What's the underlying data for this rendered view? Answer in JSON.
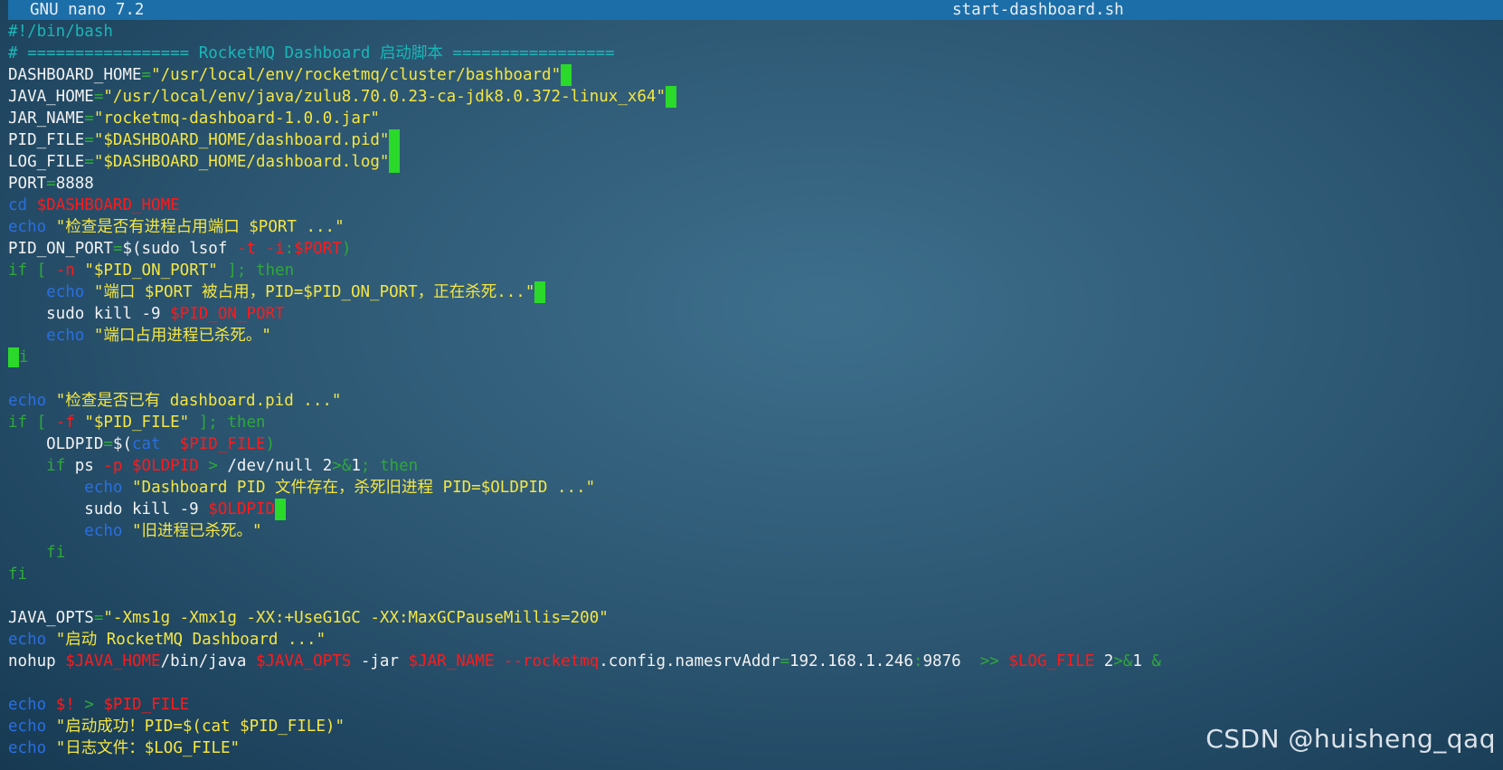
{
  "titlebar": {
    "version": "GNU nano 7.2",
    "filename": "start-dashboard.sh"
  },
  "lines": [
    [
      {
        "c": "cm",
        "t": "#!/bin/bash"
      }
    ],
    [
      {
        "c": "cm",
        "t": "# ================= RocketMQ Dashboard 启动脚本 ================="
      }
    ],
    [
      {
        "c": "pl",
        "t": "DASHBOARD_HOME"
      },
      {
        "c": "op",
        "t": "="
      },
      {
        "c": "str",
        "t": "\"/usr/local/env/rocketmq/cluster/bashboard\""
      },
      {
        "c": "tr",
        "t": ""
      }
    ],
    [
      {
        "c": "pl",
        "t": "JAVA_HOME"
      },
      {
        "c": "op",
        "t": "="
      },
      {
        "c": "str",
        "t": "\"/usr/local/env/java/zulu8.70.0.23-ca-jdk8.0.372-linux_x64\""
      },
      {
        "c": "tr",
        "t": ""
      }
    ],
    [
      {
        "c": "pl",
        "t": "JAR_NAME"
      },
      {
        "c": "op",
        "t": "="
      },
      {
        "c": "str",
        "t": "\"rocketmq-dashboard-1.0.0.jar\""
      }
    ],
    [
      {
        "c": "pl",
        "t": "PID_FILE"
      },
      {
        "c": "op",
        "t": "="
      },
      {
        "c": "str",
        "t": "\"$DASHBOARD_HOME/dashboard.pid\""
      },
      {
        "c": "tr",
        "t": ""
      }
    ],
    [
      {
        "c": "pl",
        "t": "LOG_FILE"
      },
      {
        "c": "op",
        "t": "="
      },
      {
        "c": "str",
        "t": "\"$DASHBOARD_HOME/dashboard.log\""
      },
      {
        "c": "tr",
        "t": ""
      }
    ],
    [
      {
        "c": "pl",
        "t": "PORT"
      },
      {
        "c": "op",
        "t": "="
      },
      {
        "c": "pl",
        "t": "8888"
      }
    ],
    [
      {
        "c": "cmd",
        "t": "cd"
      },
      {
        "c": "pl",
        "t": " "
      },
      {
        "c": "var",
        "t": "$DASHBOARD_HOME"
      }
    ],
    [
      {
        "c": "cmd",
        "t": "echo"
      },
      {
        "c": "pl",
        "t": " "
      },
      {
        "c": "str",
        "t": "\"检查是否有进程占用端口 $PORT ...\""
      }
    ],
    [
      {
        "c": "pl",
        "t": "PID_ON_PORT"
      },
      {
        "c": "op",
        "t": "="
      },
      {
        "c": "pl",
        "t": "$("
      },
      {
        "c": "pl",
        "t": "sudo lsof "
      },
      {
        "c": "var",
        "t": "-t -i"
      },
      {
        "c": "op",
        "t": ":"
      },
      {
        "c": "var",
        "t": "$PORT"
      },
      {
        "c": "op",
        "t": ")"
      }
    ],
    [
      {
        "c": "kw",
        "t": "if ["
      },
      {
        "c": "pl",
        "t": " "
      },
      {
        "c": "var",
        "t": "-n"
      },
      {
        "c": "pl",
        "t": " "
      },
      {
        "c": "str",
        "t": "\"$PID_ON_PORT\""
      },
      {
        "c": "kw",
        "t": " ]; then"
      }
    ],
    [
      {
        "c": "pl",
        "t": "    "
      },
      {
        "c": "cmd",
        "t": "echo"
      },
      {
        "c": "pl",
        "t": " "
      },
      {
        "c": "str",
        "t": "\"端口 $PORT 被占用，PID=$PID_ON_PORT，正在杀死...\""
      },
      {
        "c": "tr",
        "t": ""
      }
    ],
    [
      {
        "c": "pl",
        "t": "    sudo kill -9 "
      },
      {
        "c": "var",
        "t": "$PID_ON_PORT"
      }
    ],
    [
      {
        "c": "pl",
        "t": "    "
      },
      {
        "c": "cmd",
        "t": "echo"
      },
      {
        "c": "pl",
        "t": " "
      },
      {
        "c": "str",
        "t": "\"端口占用进程已杀死。\""
      }
    ],
    [
      {
        "c": "cur",
        "t": ""
      },
      {
        "c": "kw",
        "t": "i"
      }
    ],
    [],
    [
      {
        "c": "cmd",
        "t": "echo"
      },
      {
        "c": "pl",
        "t": " "
      },
      {
        "c": "str",
        "t": "\"检查是否已有 dashboard.pid ...\""
      }
    ],
    [
      {
        "c": "kw",
        "t": "if ["
      },
      {
        "c": "pl",
        "t": " "
      },
      {
        "c": "var",
        "t": "-f"
      },
      {
        "c": "pl",
        "t": " "
      },
      {
        "c": "str",
        "t": "\"$PID_FILE\""
      },
      {
        "c": "kw",
        "t": " ]; then"
      }
    ],
    [
      {
        "c": "pl",
        "t": "    OLDPID"
      },
      {
        "c": "op",
        "t": "="
      },
      {
        "c": "pl",
        "t": "$("
      },
      {
        "c": "cmd",
        "t": "cat"
      },
      {
        "c": "pl",
        "t": "  "
      },
      {
        "c": "var",
        "t": "$PID_FILE"
      },
      {
        "c": "op",
        "t": ")"
      }
    ],
    [
      {
        "c": "pl",
        "t": "    "
      },
      {
        "c": "kw",
        "t": "if"
      },
      {
        "c": "pl",
        "t": " ps "
      },
      {
        "c": "var",
        "t": "-p"
      },
      {
        "c": "pl",
        "t": " "
      },
      {
        "c": "var",
        "t": "$OLDPID"
      },
      {
        "c": "op",
        "t": " > "
      },
      {
        "c": "pl",
        "t": "/dev/null 2"
      },
      {
        "c": "op",
        "t": ">&"
      },
      {
        "c": "pl",
        "t": "1"
      },
      {
        "c": "kw",
        "t": "; then"
      }
    ],
    [
      {
        "c": "pl",
        "t": "        "
      },
      {
        "c": "cmd",
        "t": "echo"
      },
      {
        "c": "pl",
        "t": " "
      },
      {
        "c": "str",
        "t": "\"Dashboard PID 文件存在，杀死旧进程 PID=$OLDPID ...\""
      }
    ],
    [
      {
        "c": "pl",
        "t": "        sudo kill -9 "
      },
      {
        "c": "var",
        "t": "$OLDPID"
      },
      {
        "c": "tr",
        "t": ""
      }
    ],
    [
      {
        "c": "pl",
        "t": "        "
      },
      {
        "c": "cmd",
        "t": "echo"
      },
      {
        "c": "pl",
        "t": " "
      },
      {
        "c": "str",
        "t": "\"旧进程已杀死。\""
      }
    ],
    [
      {
        "c": "pl",
        "t": "    "
      },
      {
        "c": "kw",
        "t": "fi"
      }
    ],
    [
      {
        "c": "kw",
        "t": "fi"
      }
    ],
    [],
    [
      {
        "c": "pl",
        "t": "JAVA_OPTS"
      },
      {
        "c": "op",
        "t": "="
      },
      {
        "c": "str",
        "t": "\"-Xms1g -Xmx1g -XX:+UseG1GC -XX:MaxGCPauseMillis=200\""
      }
    ],
    [
      {
        "c": "cmd",
        "t": "echo"
      },
      {
        "c": "pl",
        "t": " "
      },
      {
        "c": "str",
        "t": "\"启动 RocketMQ Dashboard ...\""
      }
    ],
    [
      {
        "c": "pl",
        "t": "nohup "
      },
      {
        "c": "var",
        "t": "$JAVA_HOME"
      },
      {
        "c": "pl",
        "t": "/bin/java "
      },
      {
        "c": "var",
        "t": "$JAVA_OPTS"
      },
      {
        "c": "pl",
        "t": " -jar "
      },
      {
        "c": "var",
        "t": "$JAR_NAME"
      },
      {
        "c": "pl",
        "t": " "
      },
      {
        "c": "var",
        "t": "--rocketmq"
      },
      {
        "c": "pl",
        "t": ".config.namesrvAddr"
      },
      {
        "c": "op",
        "t": "="
      },
      {
        "c": "pl",
        "t": "192.168.1.246"
      },
      {
        "c": "op",
        "t": ":"
      },
      {
        "c": "pl",
        "t": "9876  "
      },
      {
        "c": "kw",
        "t": ">>"
      },
      {
        "c": "pl",
        "t": " "
      },
      {
        "c": "var",
        "t": "$LOG_FILE"
      },
      {
        "c": "pl",
        "t": " 2"
      },
      {
        "c": "op",
        "t": ">&"
      },
      {
        "c": "pl",
        "t": "1 "
      },
      {
        "c": "kw",
        "t": "&"
      }
    ],
    [],
    [
      {
        "c": "cmd",
        "t": "echo"
      },
      {
        "c": "pl",
        "t": " "
      },
      {
        "c": "var",
        "t": "$!"
      },
      {
        "c": "op",
        "t": " > "
      },
      {
        "c": "var",
        "t": "$PID_FILE"
      }
    ],
    [
      {
        "c": "cmd",
        "t": "echo"
      },
      {
        "c": "pl",
        "t": " "
      },
      {
        "c": "str",
        "t": "\"启动成功！PID=$(cat $PID_FILE)\""
      }
    ],
    [
      {
        "c": "cmd",
        "t": "echo"
      },
      {
        "c": "pl",
        "t": " "
      },
      {
        "c": "str",
        "t": "\"日志文件：$LOG_FILE\""
      }
    ]
  ],
  "watermark": "CSDN @huisheng_qaq",
  "colors": {
    "titlebar_bg": "#1c6ea8",
    "comment": "#19b7b7",
    "command": "#2a6fe0",
    "string": "#f5e642",
    "variable": "#ff1a1a",
    "keyword": "#2fa83a",
    "cursor": "#2bd92b"
  }
}
